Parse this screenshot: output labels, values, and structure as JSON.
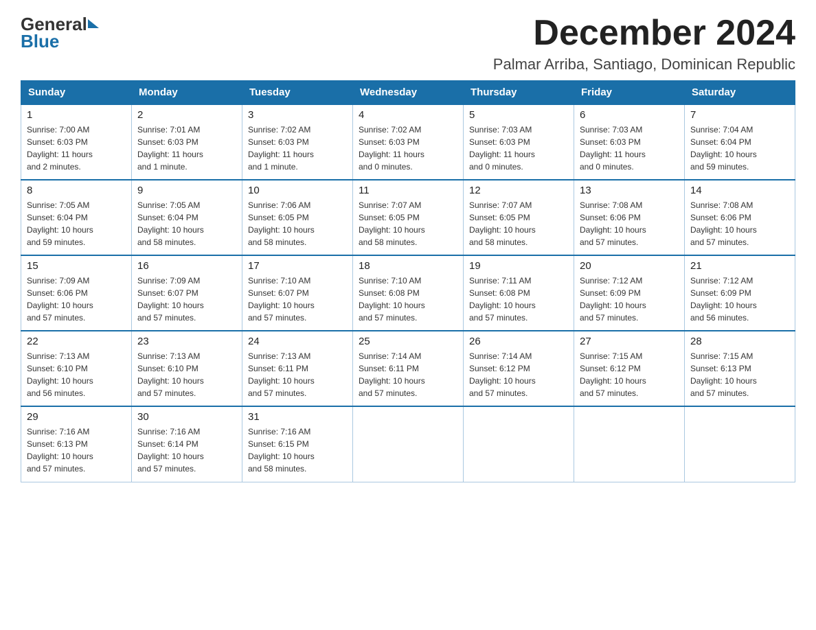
{
  "header": {
    "logo_general": "General",
    "logo_blue": "Blue",
    "month_title": "December 2024",
    "subtitle": "Palmar Arriba, Santiago, Dominican Republic"
  },
  "calendar": {
    "days_of_week": [
      "Sunday",
      "Monday",
      "Tuesday",
      "Wednesday",
      "Thursday",
      "Friday",
      "Saturday"
    ],
    "weeks": [
      [
        {
          "day": "1",
          "sunrise": "7:00 AM",
          "sunset": "6:03 PM",
          "daylight": "11 hours and 2 minutes."
        },
        {
          "day": "2",
          "sunrise": "7:01 AM",
          "sunset": "6:03 PM",
          "daylight": "11 hours and 1 minute."
        },
        {
          "day": "3",
          "sunrise": "7:02 AM",
          "sunset": "6:03 PM",
          "daylight": "11 hours and 1 minute."
        },
        {
          "day": "4",
          "sunrise": "7:02 AM",
          "sunset": "6:03 PM",
          "daylight": "11 hours and 0 minutes."
        },
        {
          "day": "5",
          "sunrise": "7:03 AM",
          "sunset": "6:03 PM",
          "daylight": "11 hours and 0 minutes."
        },
        {
          "day": "6",
          "sunrise": "7:03 AM",
          "sunset": "6:03 PM",
          "daylight": "11 hours and 0 minutes."
        },
        {
          "day": "7",
          "sunrise": "7:04 AM",
          "sunset": "6:04 PM",
          "daylight": "10 hours and 59 minutes."
        }
      ],
      [
        {
          "day": "8",
          "sunrise": "7:05 AM",
          "sunset": "6:04 PM",
          "daylight": "10 hours and 59 minutes."
        },
        {
          "day": "9",
          "sunrise": "7:05 AM",
          "sunset": "6:04 PM",
          "daylight": "10 hours and 58 minutes."
        },
        {
          "day": "10",
          "sunrise": "7:06 AM",
          "sunset": "6:05 PM",
          "daylight": "10 hours and 58 minutes."
        },
        {
          "day": "11",
          "sunrise": "7:07 AM",
          "sunset": "6:05 PM",
          "daylight": "10 hours and 58 minutes."
        },
        {
          "day": "12",
          "sunrise": "7:07 AM",
          "sunset": "6:05 PM",
          "daylight": "10 hours and 58 minutes."
        },
        {
          "day": "13",
          "sunrise": "7:08 AM",
          "sunset": "6:06 PM",
          "daylight": "10 hours and 57 minutes."
        },
        {
          "day": "14",
          "sunrise": "7:08 AM",
          "sunset": "6:06 PM",
          "daylight": "10 hours and 57 minutes."
        }
      ],
      [
        {
          "day": "15",
          "sunrise": "7:09 AM",
          "sunset": "6:06 PM",
          "daylight": "10 hours and 57 minutes."
        },
        {
          "day": "16",
          "sunrise": "7:09 AM",
          "sunset": "6:07 PM",
          "daylight": "10 hours and 57 minutes."
        },
        {
          "day": "17",
          "sunrise": "7:10 AM",
          "sunset": "6:07 PM",
          "daylight": "10 hours and 57 minutes."
        },
        {
          "day": "18",
          "sunrise": "7:10 AM",
          "sunset": "6:08 PM",
          "daylight": "10 hours and 57 minutes."
        },
        {
          "day": "19",
          "sunrise": "7:11 AM",
          "sunset": "6:08 PM",
          "daylight": "10 hours and 57 minutes."
        },
        {
          "day": "20",
          "sunrise": "7:12 AM",
          "sunset": "6:09 PM",
          "daylight": "10 hours and 57 minutes."
        },
        {
          "day": "21",
          "sunrise": "7:12 AM",
          "sunset": "6:09 PM",
          "daylight": "10 hours and 56 minutes."
        }
      ],
      [
        {
          "day": "22",
          "sunrise": "7:13 AM",
          "sunset": "6:10 PM",
          "daylight": "10 hours and 56 minutes."
        },
        {
          "day": "23",
          "sunrise": "7:13 AM",
          "sunset": "6:10 PM",
          "daylight": "10 hours and 57 minutes."
        },
        {
          "day": "24",
          "sunrise": "7:13 AM",
          "sunset": "6:11 PM",
          "daylight": "10 hours and 57 minutes."
        },
        {
          "day": "25",
          "sunrise": "7:14 AM",
          "sunset": "6:11 PM",
          "daylight": "10 hours and 57 minutes."
        },
        {
          "day": "26",
          "sunrise": "7:14 AM",
          "sunset": "6:12 PM",
          "daylight": "10 hours and 57 minutes."
        },
        {
          "day": "27",
          "sunrise": "7:15 AM",
          "sunset": "6:12 PM",
          "daylight": "10 hours and 57 minutes."
        },
        {
          "day": "28",
          "sunrise": "7:15 AM",
          "sunset": "6:13 PM",
          "daylight": "10 hours and 57 minutes."
        }
      ],
      [
        {
          "day": "29",
          "sunrise": "7:16 AM",
          "sunset": "6:13 PM",
          "daylight": "10 hours and 57 minutes."
        },
        {
          "day": "30",
          "sunrise": "7:16 AM",
          "sunset": "6:14 PM",
          "daylight": "10 hours and 57 minutes."
        },
        {
          "day": "31",
          "sunrise": "7:16 AM",
          "sunset": "6:15 PM",
          "daylight": "10 hours and 58 minutes."
        },
        null,
        null,
        null,
        null
      ]
    ],
    "labels": {
      "sunrise": "Sunrise:",
      "sunset": "Sunset:",
      "daylight": "Daylight:"
    }
  }
}
